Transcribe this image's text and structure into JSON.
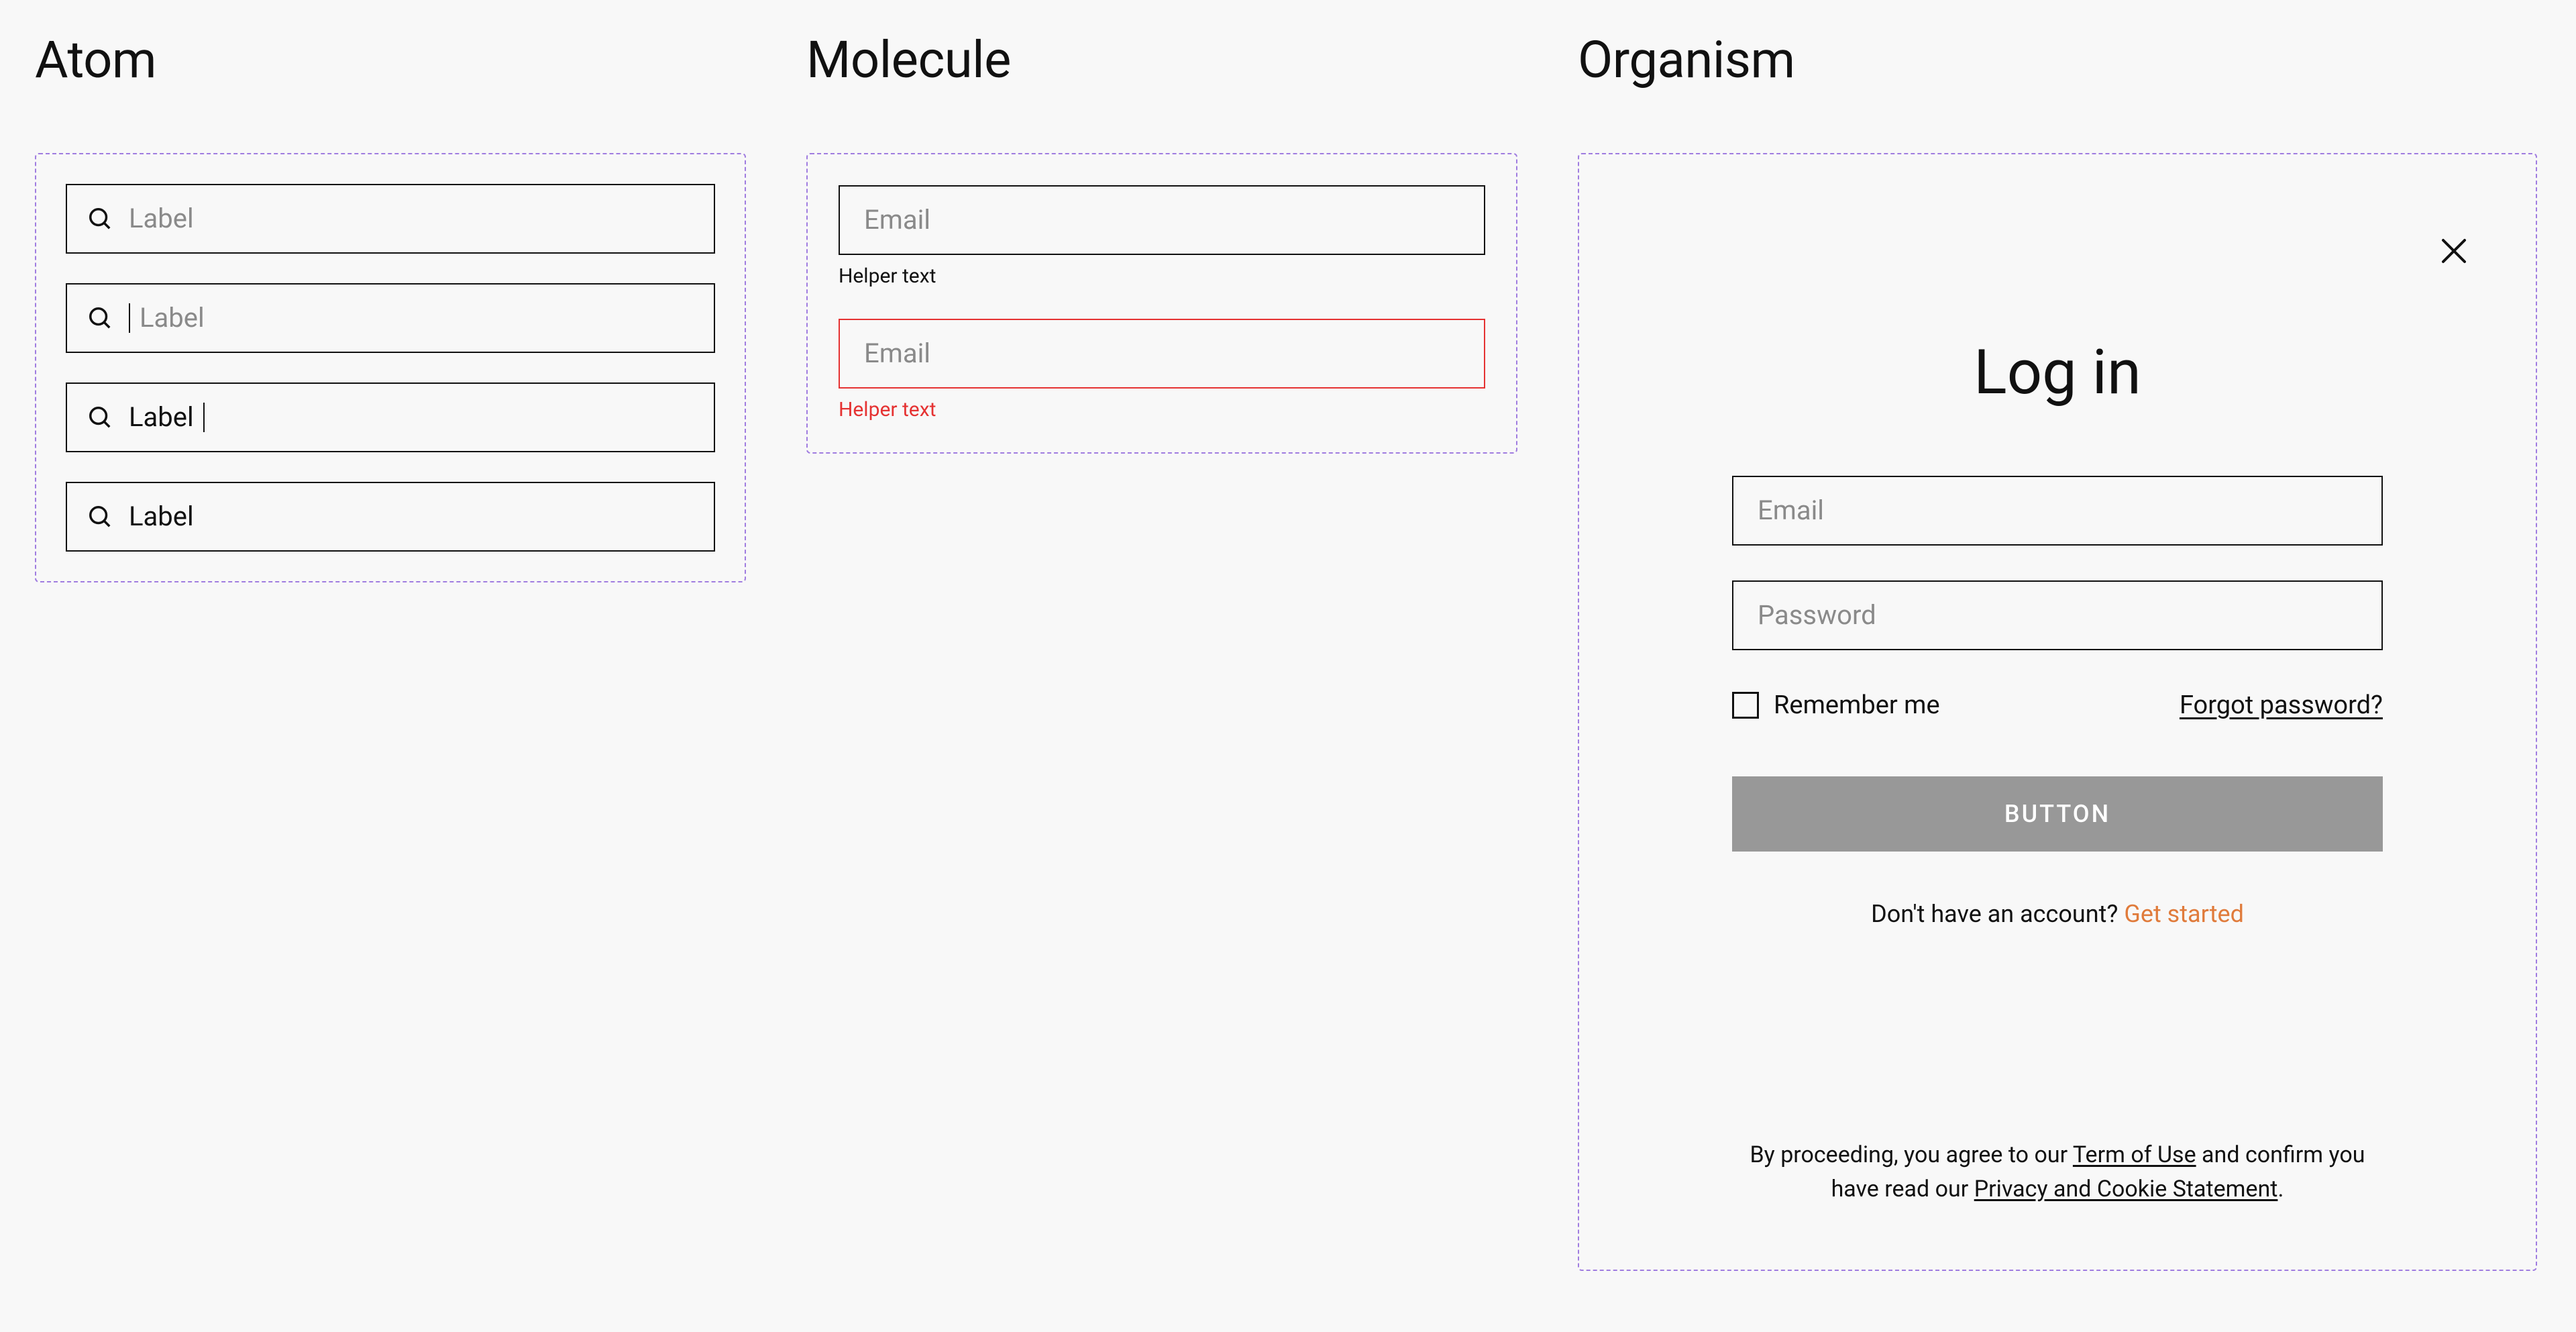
{
  "atom": {
    "heading": "Atom",
    "inputs": [
      {
        "state": "default",
        "placeholder": "Label"
      },
      {
        "state": "focus-empty",
        "placeholder": "Label"
      },
      {
        "state": "focus-filled",
        "value": "Label"
      },
      {
        "state": "filled",
        "value": "Label"
      }
    ]
  },
  "molecule": {
    "heading": "Molecule",
    "blocks": [
      {
        "placeholder": "Email",
        "helper": "Helper text",
        "error": false
      },
      {
        "placeholder": "Email",
        "helper": "Helper text",
        "error": true
      }
    ]
  },
  "organism": {
    "heading": "Organism",
    "login": {
      "title": "Log in",
      "email_placeholder": "Email",
      "password_placeholder": "Password",
      "remember_label": "Remember me",
      "remember_checked": false,
      "forgot_label": "Forgot password?",
      "button_label": "BUTTON",
      "signup_prompt": "Don't have an account? ",
      "signup_link": "Get started",
      "legal_pre": "By proceeding, you agree to our ",
      "legal_terms": "Term of Use",
      "legal_mid": " and confirm you have read our ",
      "legal_privacy": "Privacy and Cookie Statement",
      "legal_end": "."
    }
  }
}
